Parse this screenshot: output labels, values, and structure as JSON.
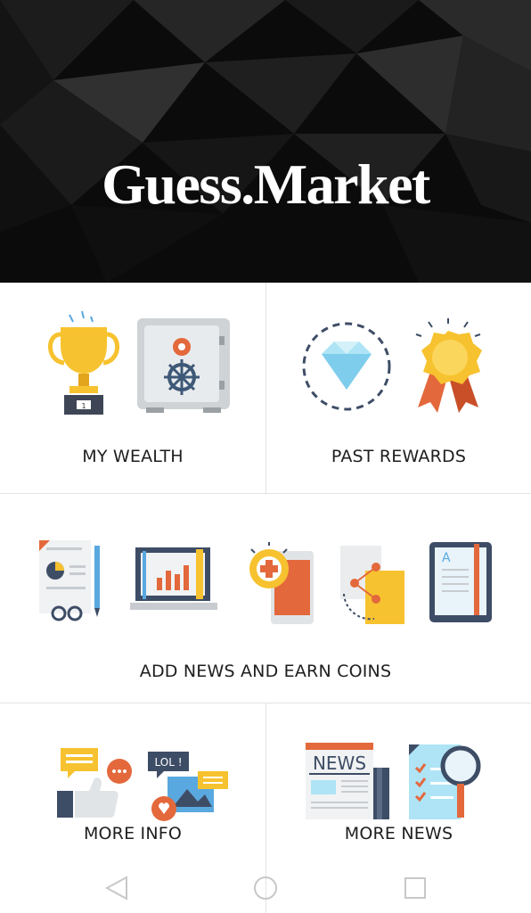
{
  "app": {
    "logo_text": "Guess.Market"
  },
  "tiles": [
    {
      "label": "MY WEALTH",
      "icons": [
        "trophy-icon",
        "safe-icon"
      ]
    },
    {
      "label": "PAST REWARDS",
      "icons": [
        "diamond-icon",
        "award-badge-icon"
      ]
    },
    {
      "label": "ADD NEWS AND EARN COINS",
      "icons": [
        "report-document-icon",
        "laptop-chart-icon",
        "phone-health-icon",
        "share-document-icon",
        "tablet-icon"
      ]
    },
    {
      "label": "MORE INFO",
      "icons": [
        "chat-like-icon",
        "lol-media-icon"
      ]
    },
    {
      "label": "MORE NEWS",
      "icons": [
        "newspaper-icon",
        "checklist-search-icon"
      ]
    }
  ],
  "nav": {
    "buttons": [
      "back-icon",
      "home-icon",
      "recents-icon"
    ]
  },
  "colors": {
    "hero_bg": "#0b0b0b",
    "divider": "#e3e3e3",
    "text": "#1e1e1e"
  }
}
